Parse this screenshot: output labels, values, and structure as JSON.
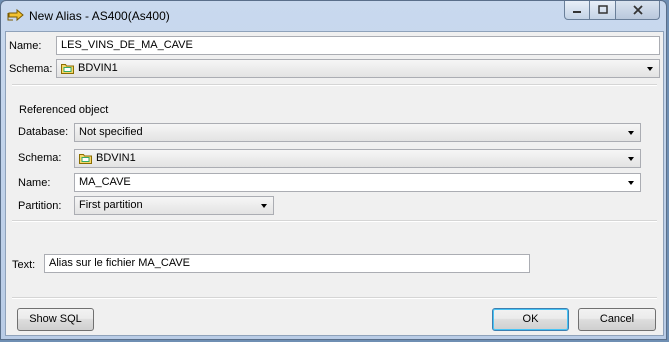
{
  "window": {
    "title": "New Alias - AS400(As400)"
  },
  "form": {
    "name_label": "Name:",
    "name_value": "LES_VINS_DE_MA_CAVE",
    "schema_label": "Schema:",
    "schema_value": "BDVIN1"
  },
  "referenced": {
    "title": "Referenced object",
    "database_label": "Database:",
    "database_value": "Not specified",
    "schema_label": "Schema:",
    "schema_value": "BDVIN1",
    "name_label": "Name:",
    "name_value": "MA_CAVE",
    "partition_label": "Partition:",
    "partition_value": "First partition"
  },
  "text": {
    "label": "Text:",
    "value": "Alias sur le fichier MA_CAVE"
  },
  "buttons": {
    "show_sql": "Show SQL",
    "ok": "OK",
    "cancel": "Cancel"
  },
  "icons": {
    "title": "alias-arrow-icon",
    "schema": "schema-folder-icon",
    "minimize": "minimize-icon",
    "maximize": "maximize-icon",
    "close": "close-icon"
  },
  "colors": {
    "titlebar": "#c9d9ee",
    "client": "#f0f0f0",
    "default_button_border": "#3c7fb1"
  }
}
